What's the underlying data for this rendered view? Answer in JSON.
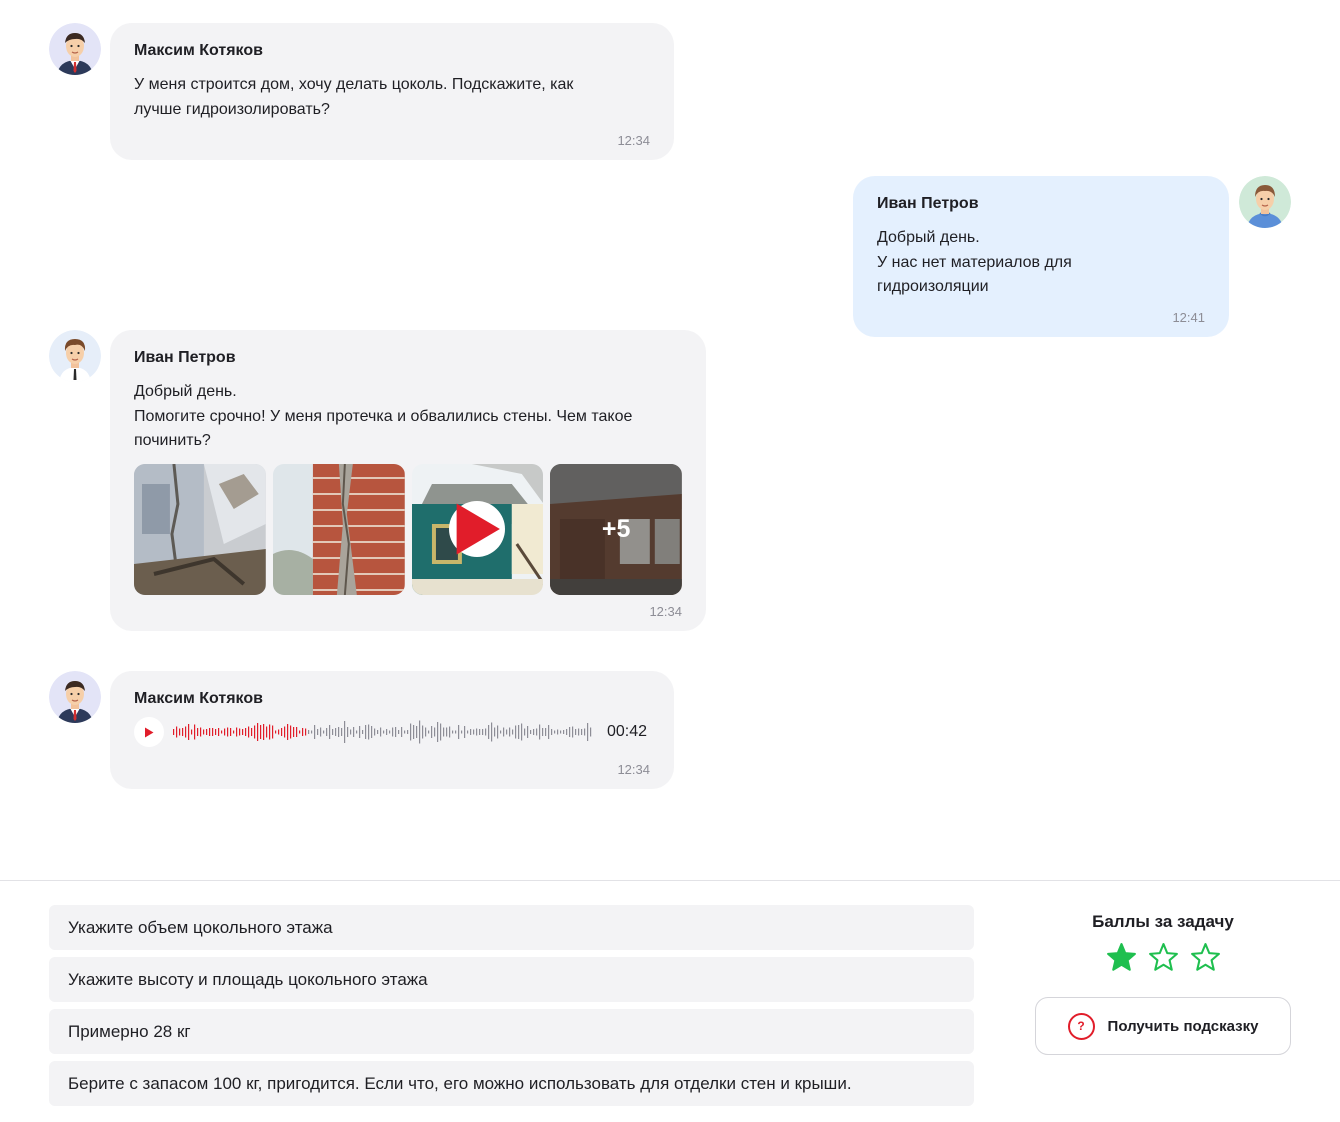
{
  "messages": [
    {
      "author": "Максим Котяков",
      "lines": [
        "У меня строится дом, хочу делать цоколь. Подскажите, как",
        "лучше гидроизолировать?"
      ],
      "time": "12:34"
    },
    {
      "author": "Иван Петров",
      "lines": [
        "Добрый день.",
        "У нас нет материалов для",
        "гидроизоляции"
      ],
      "time": "12:41"
    },
    {
      "author": "Иван Петров",
      "lines": [
        "Добрый день.",
        "Помогите срочно! У меня протечка и обвалились стены. Чем такое",
        "починить?"
      ],
      "media_more": "+5",
      "time": "12:34"
    },
    {
      "author": "Максим Котяков",
      "audio_duration": "00:42",
      "audio_progress": 0.32,
      "time": "12:34"
    }
  ],
  "answers": [
    "Укажите объем цокольного этажа",
    "Укажите высоту и площадь цокольного этажа",
    "Примерно 28 кг",
    "Берите с запасом 100 кг, пригодится. Если что, его можно использовать для отделки стен и крыши."
  ],
  "score": {
    "title": "Баллы за задачу",
    "stars_filled": 1,
    "stars_total": 3
  },
  "hint_button": {
    "icon_text": "?",
    "label": "Получить подсказку"
  },
  "colors": {
    "accent_red": "#e11d2a",
    "star_green": "#1fbf4f",
    "bubble_gray": "#f3f3f5",
    "bubble_blue": "#e4f0fe"
  },
  "icons": [
    "avatar-maksim",
    "avatar-ivan-light",
    "avatar-ivan-dark",
    "play-icon",
    "star-icon",
    "question-icon"
  ]
}
